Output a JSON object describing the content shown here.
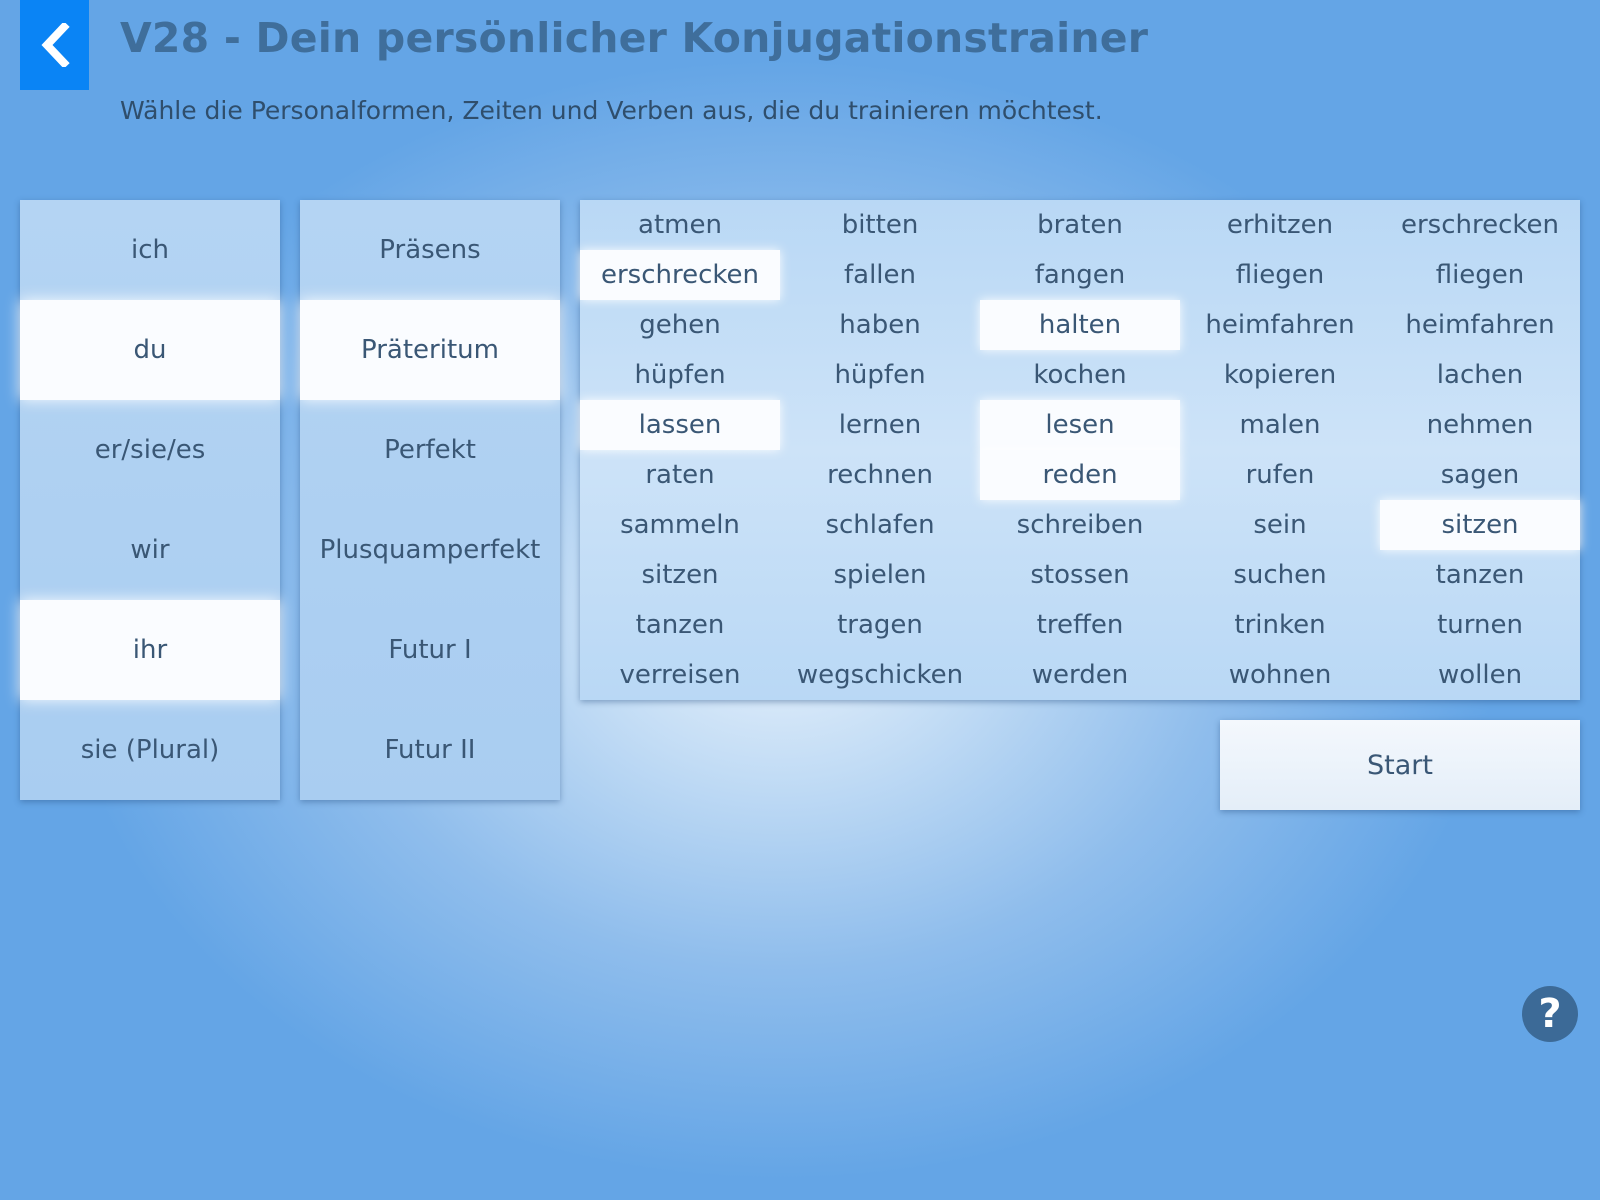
{
  "header": {
    "title": "V28 - Dein persönlicher Konjugationstrainer",
    "subtitle": "Wähle die Personalformen, Zeiten und Verben aus, die du trainieren möchtest.",
    "back_icon": "chevron-left-icon"
  },
  "persons": [
    {
      "label": "ich",
      "selected": false
    },
    {
      "label": "du",
      "selected": true
    },
    {
      "label": "er/sie/es",
      "selected": false
    },
    {
      "label": "wir",
      "selected": false
    },
    {
      "label": "ihr",
      "selected": true
    },
    {
      "label": "sie (Plural)",
      "selected": false
    }
  ],
  "tenses": [
    {
      "label": "Präsens",
      "selected": false
    },
    {
      "label": "Präteritum",
      "selected": true
    },
    {
      "label": "Perfekt",
      "selected": false
    },
    {
      "label": "Plusquamperfekt",
      "selected": false
    },
    {
      "label": "Futur I",
      "selected": false
    },
    {
      "label": "Futur II",
      "selected": false
    }
  ],
  "verbs": [
    {
      "label": "atmen",
      "selected": false
    },
    {
      "label": "bitten",
      "selected": false
    },
    {
      "label": "braten",
      "selected": false
    },
    {
      "label": "erhitzen",
      "selected": false
    },
    {
      "label": "erschrecken",
      "selected": false
    },
    {
      "label": "erschrecken",
      "selected": true
    },
    {
      "label": "fallen",
      "selected": false
    },
    {
      "label": "fangen",
      "selected": false
    },
    {
      "label": "fliegen",
      "selected": false
    },
    {
      "label": "fliegen",
      "selected": false
    },
    {
      "label": "gehen",
      "selected": false
    },
    {
      "label": "haben",
      "selected": false
    },
    {
      "label": "halten",
      "selected": true
    },
    {
      "label": "heimfahren",
      "selected": false
    },
    {
      "label": "heimfahren",
      "selected": false
    },
    {
      "label": "hüpfen",
      "selected": false
    },
    {
      "label": "hüpfen",
      "selected": false
    },
    {
      "label": "kochen",
      "selected": false
    },
    {
      "label": "kopieren",
      "selected": false
    },
    {
      "label": "lachen",
      "selected": false
    },
    {
      "label": "lassen",
      "selected": true
    },
    {
      "label": "lernen",
      "selected": false
    },
    {
      "label": "lesen",
      "selected": true
    },
    {
      "label": "malen",
      "selected": false
    },
    {
      "label": "nehmen",
      "selected": false
    },
    {
      "label": "raten",
      "selected": false
    },
    {
      "label": "rechnen",
      "selected": false
    },
    {
      "label": "reden",
      "selected": true
    },
    {
      "label": "rufen",
      "selected": false
    },
    {
      "label": "sagen",
      "selected": false
    },
    {
      "label": "sammeln",
      "selected": false
    },
    {
      "label": "schlafen",
      "selected": false
    },
    {
      "label": "schreiben",
      "selected": false
    },
    {
      "label": "sein",
      "selected": false
    },
    {
      "label": "sitzen",
      "selected": true
    },
    {
      "label": "sitzen",
      "selected": false
    },
    {
      "label": "spielen",
      "selected": false
    },
    {
      "label": "stossen",
      "selected": false
    },
    {
      "label": "suchen",
      "selected": false
    },
    {
      "label": "tanzen",
      "selected": false
    },
    {
      "label": "tanzen",
      "selected": false
    },
    {
      "label": "tragen",
      "selected": false
    },
    {
      "label": "treffen",
      "selected": false
    },
    {
      "label": "trinken",
      "selected": false
    },
    {
      "label": "turnen",
      "selected": false
    },
    {
      "label": "verreisen",
      "selected": false
    },
    {
      "label": "wegschicken",
      "selected": false
    },
    {
      "label": "werden",
      "selected": false
    },
    {
      "label": "wohnen",
      "selected": false
    },
    {
      "label": "wollen",
      "selected": false
    }
  ],
  "start_label": "Start",
  "help": {
    "glyph": "?",
    "icon": "question-mark-icon"
  },
  "colors": {
    "accent_blue": "#0a84f5",
    "title_color": "#3f6e9b",
    "help_button": "#3c6a97",
    "selected_bg": "#fafcff"
  }
}
